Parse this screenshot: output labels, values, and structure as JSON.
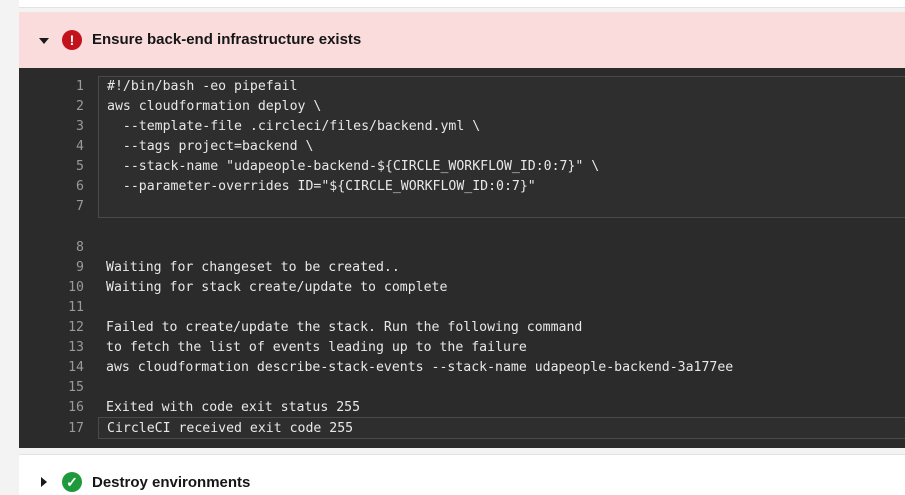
{
  "failed_step": {
    "title": "Ensure back-end infrastructure exists",
    "status_icon": "!",
    "colors": {
      "header_bg": "#fbdcdc",
      "icon_bg": "#c2121c",
      "log_bg": "#2b2b2b"
    }
  },
  "log_lines": [
    {
      "n": "1",
      "text": "#!/bin/bash -eo pipefail",
      "in_box": true
    },
    {
      "n": "2",
      "text": "aws cloudformation deploy \\",
      "in_box": true
    },
    {
      "n": "3",
      "text": "  --template-file .circleci/files/backend.yml \\",
      "in_box": true
    },
    {
      "n": "4",
      "text": "  --tags project=backend \\",
      "in_box": true
    },
    {
      "n": "5",
      "text": "  --stack-name \"udapeople-backend-${CIRCLE_WORKFLOW_ID:0:7}\" \\",
      "in_box": true
    },
    {
      "n": "6",
      "text": "  --parameter-overrides ID=\"${CIRCLE_WORKFLOW_ID:0:7}\"",
      "in_box": true
    },
    {
      "n": "7",
      "text": "",
      "in_box": true
    },
    {
      "n": "8",
      "text": "",
      "in_box": false
    },
    {
      "n": "9",
      "text": "Waiting for changeset to be created..",
      "in_box": false
    },
    {
      "n": "10",
      "text": "Waiting for stack create/update to complete",
      "in_box": false
    },
    {
      "n": "11",
      "text": "",
      "in_box": false
    },
    {
      "n": "12",
      "text": "Failed to create/update the stack. Run the following command",
      "in_box": false
    },
    {
      "n": "13",
      "text": "to fetch the list of events leading up to the failure",
      "in_box": false
    },
    {
      "n": "14",
      "text": "aws cloudformation describe-stack-events --stack-name udapeople-backend-3a177ee",
      "in_box": false
    },
    {
      "n": "15",
      "text": "",
      "in_box": false
    },
    {
      "n": "16",
      "text": "Exited with code exit status 255",
      "in_box": false
    },
    {
      "n": "17",
      "text": "CircleCI received exit code 255",
      "in_box": true
    }
  ],
  "next_step": {
    "title": "Destroy environments",
    "status_icon": "✓",
    "colors": {
      "icon_bg": "#1e9a3c"
    }
  }
}
